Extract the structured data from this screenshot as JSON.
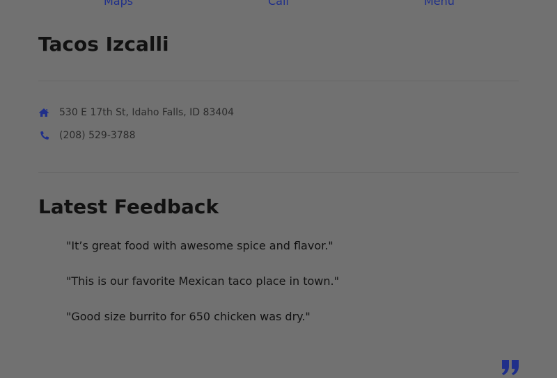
{
  "nav_actions": {
    "maps_label": "Maps",
    "call_label": "Call",
    "menu_label": "Menu"
  },
  "restaurant": {
    "name": "Tacos Izcalli",
    "address": "530 E 17th St, Idaho Falls, ID 83404",
    "phone": "(208) 529-3788"
  },
  "feedback": {
    "title": "Latest Feedback",
    "items": [
      "\"It’s great food with awesome spice and flavor.\"",
      "\"This is our favorite Mexican taco place in town.\"",
      "\"Good size burrito for 650 chicken was dry.\""
    ]
  },
  "icons": {
    "address": "home-icon",
    "phone": "phone-icon",
    "quote": "quote-icon"
  },
  "colors": {
    "overlay_background": "#717171",
    "accent": "#1f2f8a",
    "text": "#111111"
  }
}
